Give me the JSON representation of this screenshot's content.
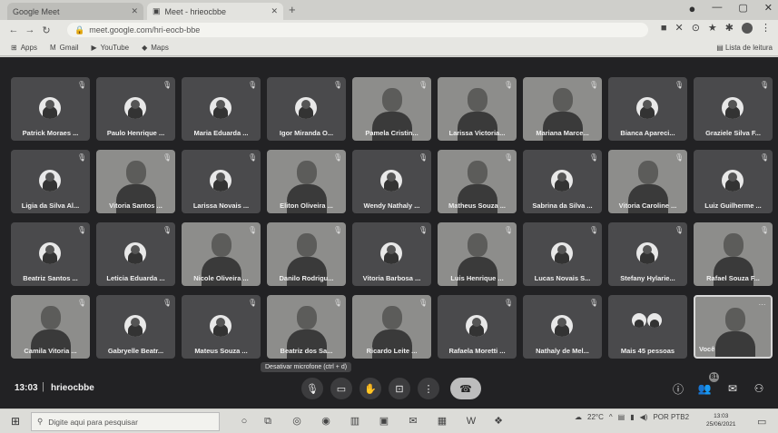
{
  "browser": {
    "tabs": [
      {
        "label": "Google Meet"
      },
      {
        "label": "Meet - hrieocbbe"
      }
    ],
    "new_tab": "+",
    "address": "meet.google.com/hri-eocb-bbe",
    "bookmarks": [
      {
        "label": "Apps",
        "icon": "grid-icon"
      },
      {
        "label": "Gmail",
        "icon": "mail-icon"
      },
      {
        "label": "YouTube",
        "icon": "youtube-icon"
      },
      {
        "label": "Maps",
        "icon": "map-icon"
      }
    ],
    "reading_list": "Lista de leitura"
  },
  "participants": [
    {
      "name": "Patrick Moraes ...",
      "video": false
    },
    {
      "name": "Paulo Henrique ...",
      "video": false
    },
    {
      "name": "Maria Eduarda ...",
      "video": false
    },
    {
      "name": "Igor Miranda O...",
      "video": false
    },
    {
      "name": "Pamela Cristin...",
      "video": true
    },
    {
      "name": "Larissa Victoria...",
      "video": true
    },
    {
      "name": "Mariana Marce...",
      "video": true
    },
    {
      "name": "Bianca Apareci...",
      "video": false
    },
    {
      "name": "Graziele Silva F...",
      "video": false
    },
    {
      "name": "Ligia da Silva Al...",
      "video": false
    },
    {
      "name": "Vitoria Santos ...",
      "video": true
    },
    {
      "name": "Larissa Novais ...",
      "video": false
    },
    {
      "name": "Eliton Oliveira ...",
      "video": true
    },
    {
      "name": "Wendy Nathaly ...",
      "video": false
    },
    {
      "name": "Matheus Souza ...",
      "video": true
    },
    {
      "name": "Sabrina da Silva ...",
      "video": false
    },
    {
      "name": "Vitoria Caroline ...",
      "video": true
    },
    {
      "name": "Luiz Guilherme ...",
      "video": false
    },
    {
      "name": "Beatriz Santos ...",
      "video": false
    },
    {
      "name": "Leticia Eduarda ...",
      "video": false
    },
    {
      "name": "Nicole Oliveira ...",
      "video": true
    },
    {
      "name": "Danilo Rodrigu...",
      "video": true
    },
    {
      "name": "Vitoria Barbosa ...",
      "video": false
    },
    {
      "name": "Luis Henrique ...",
      "video": true
    },
    {
      "name": "Lucas Novais S...",
      "video": false
    },
    {
      "name": "Stefany Hylarie...",
      "video": false
    },
    {
      "name": "Rafael Souza F...",
      "video": true
    },
    {
      "name": "Camila Vitoria ...",
      "video": true
    },
    {
      "name": "Gabryelle Beatr...",
      "video": false
    },
    {
      "name": "Mateus Souza ...",
      "video": false
    },
    {
      "name": "Beatriz dos Sa...",
      "video": true
    },
    {
      "name": "Ricardo Leite ...",
      "video": true
    },
    {
      "name": "Rafaela Moretti ...",
      "video": false
    },
    {
      "name": "Nathaly de Mel...",
      "video": false
    }
  ],
  "more_tile": {
    "label": "Mais 45 pessoas"
  },
  "self_tile": {
    "label": "Você"
  },
  "bottom_bar": {
    "time": "13:03",
    "separator": "|",
    "meeting_code": "hrieocbbe",
    "tooltip": "Desativar microfone (ctrl + d)",
    "people_count": "81"
  },
  "taskbar": {
    "search_placeholder": "Digite aqui para pesquisar",
    "weather": "22°C",
    "lang": "POR",
    "lang2": "PTB2",
    "clock_time": "13:03",
    "clock_date": "25/06/2021"
  },
  "colors": {
    "meet_bg": "#222224",
    "tile_bg": "#4a4a4c",
    "hangup": "#bdbdbd"
  }
}
